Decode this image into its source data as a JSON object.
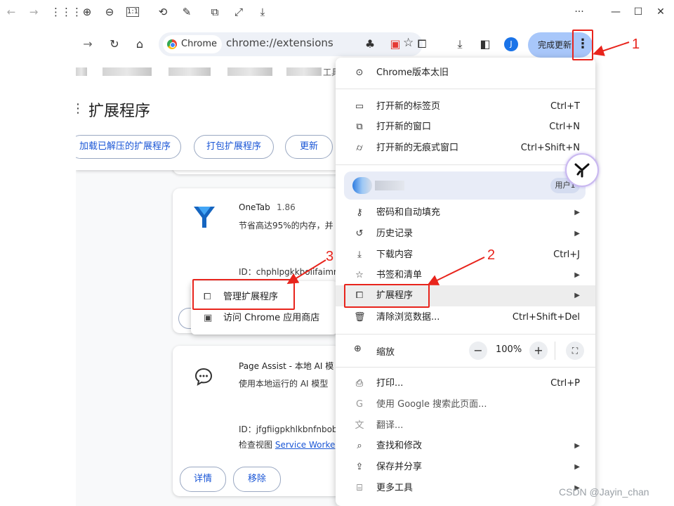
{
  "viewer": {
    "icons": [
      "back-arrow-icon",
      "forward-arrow-icon",
      "grid-icon",
      "zoom-in-icon",
      "zoom-out-icon",
      "actual-size-icon",
      "rotate-icon",
      "edit-icon",
      "crop-icon",
      "fullscreen-icon",
      "save-icon"
    ],
    "window_controls": {
      "more": "···",
      "minimize": "—",
      "maximize": "☐",
      "close": "✕"
    }
  },
  "toolbar": {
    "omnibox_chip": "Chrome",
    "url": "chrome://extensions",
    "update_button": "完成更新",
    "profile_initial": "J"
  },
  "bookmarks_partial_text": "工具",
  "extensions_page": {
    "title": "扩展程序",
    "buttons": [
      "加载已解压的扩展程序",
      "打包扩展程序",
      "更新"
    ],
    "cards": [
      {
        "name": "OneTab",
        "version": "1.86",
        "description": "节省高达95%的内存，并",
        "id": "ID：chphlpgkkbolifaimn"
      },
      {
        "name": "Page Assist - 本地 AI 模",
        "description": "使用本地运行的 AI 模型",
        "id": "ID：jfgfiigpkhlkbnfnbob",
        "inspect_label": "检查视图",
        "inspect_link": "Service Worke",
        "details_button": "详情",
        "remove_button": "移除"
      }
    ]
  },
  "context_menu": {
    "items": [
      {
        "label": "管理扩展程序",
        "icon": "puzzle-icon"
      },
      {
        "label": "访问 Chrome 应用商店",
        "icon": "store-icon"
      }
    ]
  },
  "chrome_menu": {
    "header": "Chrome版本太旧",
    "items_group1": [
      {
        "label": "打开新的标签页",
        "shortcut": "Ctrl+T"
      },
      {
        "label": "打开新的窗口",
        "shortcut": "Ctrl+N"
      },
      {
        "label": "打开新的无痕式窗口",
        "shortcut": "Ctrl+Shift+N"
      }
    ],
    "profile_badge": "用户1",
    "items_group2": [
      {
        "label": "密码和自动填充",
        "shortcut": ""
      },
      {
        "label": "历史记录",
        "shortcut": ""
      },
      {
        "label": "下载内容",
        "shortcut": "Ctrl+J"
      },
      {
        "label": "书签和清单",
        "shortcut": ""
      },
      {
        "label": "扩展程序",
        "shortcut": ""
      },
      {
        "label": "清除浏览数据...",
        "shortcut": "Ctrl+Shift+Del"
      }
    ],
    "zoom_label": "缩放",
    "zoom_value": "100%",
    "zoom_minus": "−",
    "zoom_plus": "+",
    "items_group3": [
      {
        "label": "打印...",
        "shortcut": "Ctrl+P"
      },
      {
        "label": "使用 Google 搜索此页面...",
        "shortcut": ""
      },
      {
        "label": "翻译...",
        "shortcut": ""
      },
      {
        "label": "查找和修改",
        "shortcut": ""
      },
      {
        "label": "保存并分享",
        "shortcut": ""
      },
      {
        "label": "更多工具",
        "shortcut": ""
      }
    ]
  },
  "annotations": {
    "n1": "1",
    "n2": "2",
    "n3": "3",
    "color": "#e8241c"
  },
  "watermark": "CSDN @Jayin_chan"
}
